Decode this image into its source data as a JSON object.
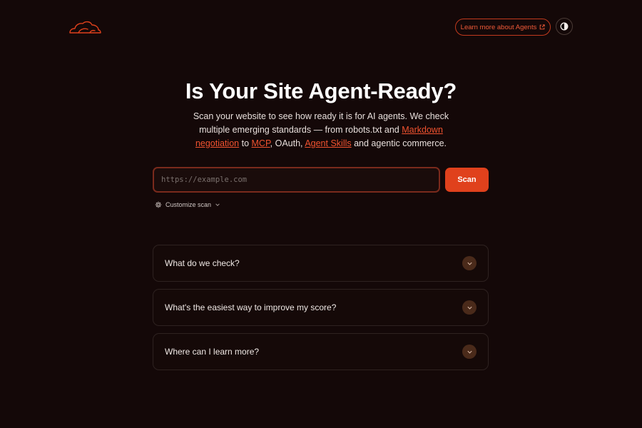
{
  "header": {
    "learn_more_label": "Learn more about Agents",
    "logo_icon": "cloud-logo-icon",
    "theme_icon": "half-circle-contrast-icon"
  },
  "hero": {
    "title": "Is Your Site Agent-Ready?",
    "desc_part1": "Scan your website to see how ready it is for AI agents. We check multiple emerging standards — from robots.txt and ",
    "link_markdown": "Markdown negotiation",
    "desc_part2": " to ",
    "link_mcp": "MCP",
    "desc_part3": ", OAuth, ",
    "link_skills": "Agent Skills",
    "desc_part4": " and agentic commerce."
  },
  "scan": {
    "placeholder": "https://example.com",
    "value": "",
    "button_label": "Scan",
    "customize_label": "Customize scan"
  },
  "faq": [
    {
      "question": "What do we check?"
    },
    {
      "question": "What's the easiest way to improve my score?"
    },
    {
      "question": "Where can I learn more?"
    }
  ],
  "colors": {
    "background": "#140808",
    "accent": "#e0411c",
    "link": "#f0522f"
  }
}
